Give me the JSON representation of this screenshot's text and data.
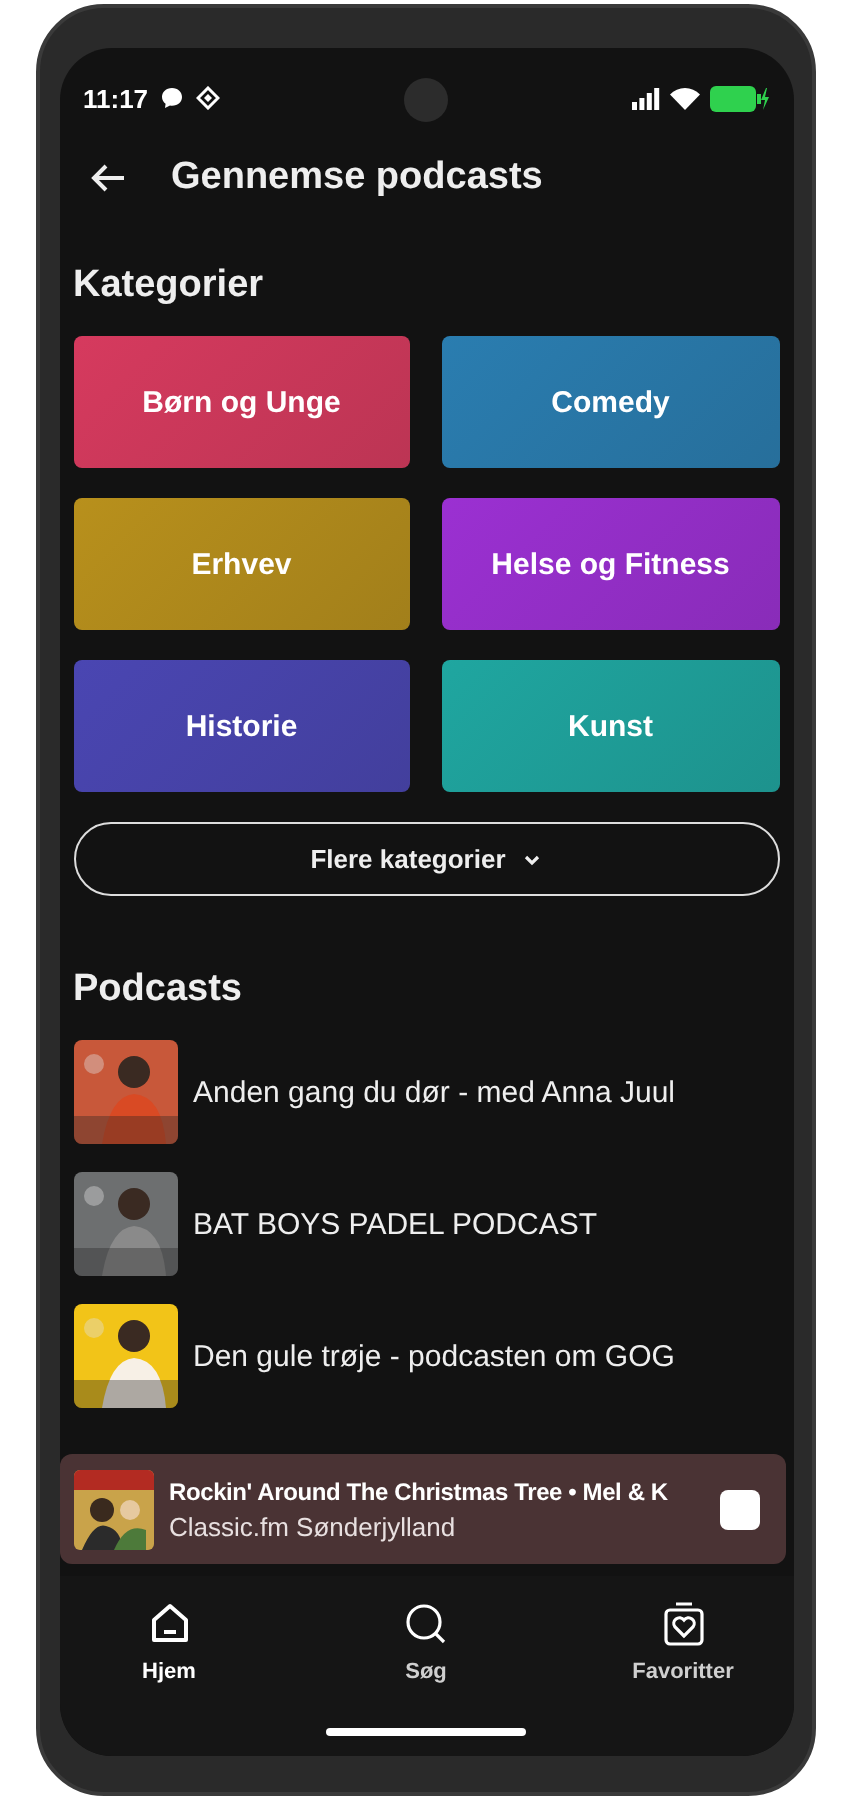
{
  "status_bar": {
    "time": "11:17"
  },
  "header": {
    "title": "Gennemse podcasts"
  },
  "categories": {
    "title": "Kategorier",
    "items": [
      {
        "label": "Børn og Unge",
        "color": "#d63a5e"
      },
      {
        "label": "Comedy",
        "color": "#2a7db0"
      },
      {
        "label": "Erhvev",
        "color": "#b8901c"
      },
      {
        "label": "Helse og Fitness",
        "color": "#9b30d2"
      },
      {
        "label": "Historie",
        "color": "#4a46b2"
      },
      {
        "label": "Kunst",
        "color": "#1fa6a0"
      }
    ],
    "more_button": "Flere kategorier"
  },
  "podcasts": {
    "title": "Podcasts",
    "items": [
      {
        "title": "Anden gang du dør - med Anna Juul"
      },
      {
        "title": "BAT BOYS PADEL PODCAST"
      },
      {
        "title": "Den gule trøje - podcasten om GOG"
      }
    ]
  },
  "player": {
    "title": "Rockin' Around The Christmas Tree • Mel & K",
    "subtitle": "Classic.fm Sønderjylland",
    "playing": true
  },
  "nav": [
    {
      "label": "Hjem",
      "kind": "home",
      "selected": true
    },
    {
      "label": "Søg",
      "kind": "search",
      "selected": false
    },
    {
      "label": "Favoritter",
      "kind": "favorites",
      "selected": false
    }
  ]
}
